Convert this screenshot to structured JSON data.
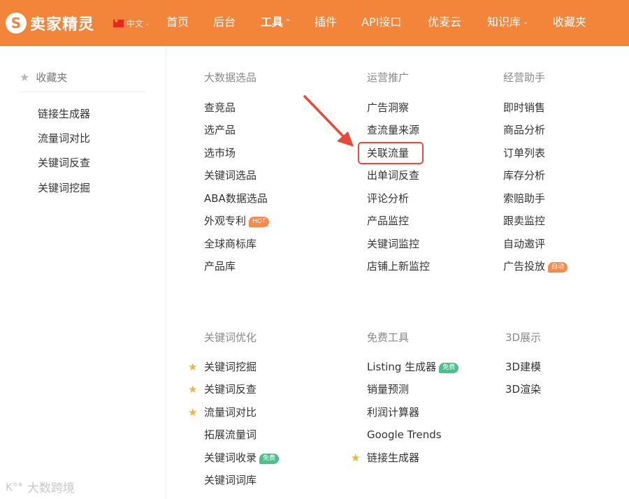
{
  "header": {
    "logo_glyph": "S",
    "logo_text": "卖家精灵",
    "language": "中文",
    "nav": [
      {
        "label": "首页",
        "active": false
      },
      {
        "label": "后台",
        "active": false
      },
      {
        "label": "工具",
        "active": true,
        "dropdown": true
      },
      {
        "label": "插件",
        "active": false
      },
      {
        "label": "API接口",
        "active": false
      },
      {
        "label": "优麦云",
        "active": false
      },
      {
        "label": "知识库",
        "active": false,
        "dropdown": true
      },
      {
        "label": "收藏夹",
        "active": false
      }
    ]
  },
  "favorites": {
    "title": "收藏夹",
    "items": [
      "链接生成器",
      "流量词对比",
      "关键词反查",
      "关键词挖掘"
    ]
  },
  "sections": {
    "big_data": {
      "title": "大数据选品",
      "items": [
        "查竞品",
        "选产品",
        "选市场",
        "关键词选品",
        "ABA数据选品",
        "外观专利",
        "全球商标库",
        "产品库"
      ],
      "hot_badge": "HOT"
    },
    "ops": {
      "title": "运营推广",
      "items": [
        "广告洞察",
        "查流量来源",
        "关联流量",
        "出单词反查",
        "评论分析",
        "产品监控",
        "关键词监控",
        "店铺上新监控"
      ]
    },
    "assistant": {
      "title": "经营助手",
      "items": [
        "即时销售",
        "商品分析",
        "订单列表",
        "库存分析",
        "索赔助手",
        "跟卖监控",
        "自动邀评",
        "广告投放"
      ],
      "auto_badge": "自动"
    },
    "keyword_opt": {
      "title": "关键词优化",
      "items": [
        "关键词挖掘",
        "关键词反查",
        "流量词对比",
        "拓展流量词",
        "关键词收录",
        "关键词词库"
      ],
      "free_badge": "免费"
    },
    "free_tools": {
      "title": "免费工具",
      "items": [
        "Listing 生成器",
        "销量预测",
        "利润计算器",
        "Google Trends",
        "链接生成器"
      ],
      "free_badge": "免费"
    },
    "three_d": {
      "title": "3D展示",
      "items": [
        "3D建模",
        "3D渲染"
      ]
    }
  },
  "watermark": {
    "icon": "K°°",
    "text": "大数跨境"
  },
  "colors": {
    "header_bg": "#f2853a",
    "highlight": "#e54a3b",
    "star": "#f5b23a",
    "free_badge": "#4cc08c",
    "hot_badge": "#f58a4a"
  }
}
